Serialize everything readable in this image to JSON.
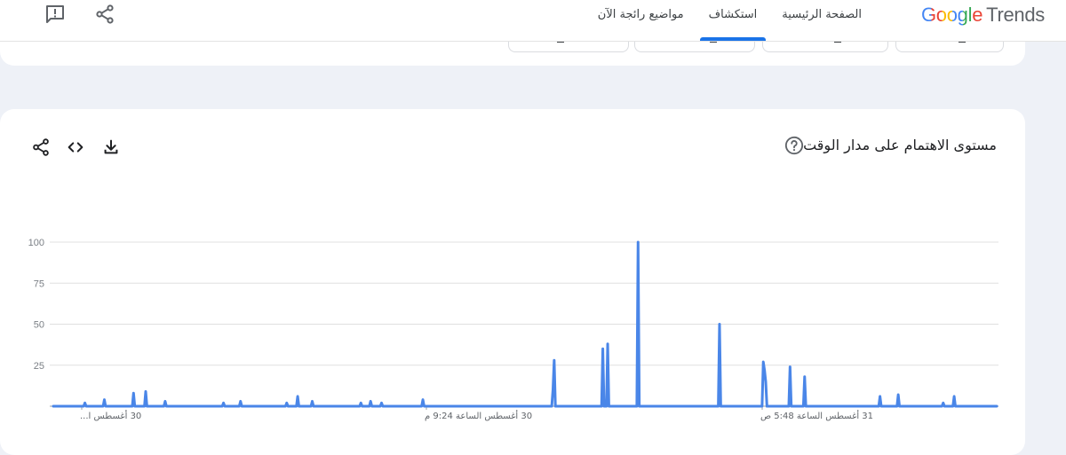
{
  "header": {
    "logo_google": "Google",
    "logo_trends": "Trends",
    "nav": [
      {
        "label": "الصفحة الرئيسية",
        "active": false
      },
      {
        "label": "استكشاف",
        "active": true
      },
      {
        "label": "مواضيع رائجة الآن",
        "active": false
      }
    ],
    "icons": [
      "feedback-icon",
      "share-icon"
    ]
  },
  "card": {
    "title": "مستوى الاهتمام على مدار الوقت",
    "icons": [
      "help-icon",
      "download-icon",
      "embed-icon",
      "share-icon"
    ]
  },
  "colors": {
    "accent": "#1a73e8",
    "series": "#4a86e8",
    "grid": "#e0e0e0"
  },
  "chart_data": {
    "type": "line",
    "title": "",
    "ylim": [
      0,
      100
    ],
    "yticks": [
      25,
      50,
      75,
      100
    ],
    "grid": true,
    "xtick_labels": [
      "30 أغسطس ا...",
      "30 أغسطس الساعة 9:24 م",
      "31 أغسطس الساعة 5:48 ص"
    ],
    "series": [
      {
        "values": [
          0,
          0,
          0,
          0,
          0,
          0,
          0,
          0,
          0,
          0,
          0,
          0,
          0,
          0,
          0,
          0,
          0,
          0,
          0,
          0,
          0,
          0,
          0,
          0,
          0,
          0,
          2,
          0,
          0,
          0,
          0,
          0,
          0,
          0,
          0,
          0,
          0,
          0,
          0,
          0,
          0,
          0,
          4,
          0,
          0,
          0,
          0,
          0,
          0,
          0,
          0,
          0,
          0,
          0,
          0,
          0,
          0,
          0,
          0,
          0,
          0,
          0,
          0,
          0,
          0,
          0,
          8,
          0,
          0,
          0,
          0,
          0,
          0,
          0,
          0,
          0,
          9,
          0,
          0,
          0,
          0,
          0,
          0,
          0,
          0,
          0,
          0,
          0,
          0,
          0,
          0,
          0,
          3,
          0,
          0,
          0,
          0,
          0,
          0,
          0,
          0,
          0,
          0,
          0,
          0,
          0,
          0,
          0,
          0,
          0,
          0,
          0,
          0,
          0,
          0,
          0,
          0,
          0,
          0,
          0,
          0,
          0,
          0,
          0,
          0,
          0,
          0,
          0,
          0,
          0,
          0,
          0,
          0,
          0,
          0,
          0,
          0,
          0,
          0,
          0,
          2,
          0,
          0,
          0,
          0,
          0,
          0,
          0,
          0,
          0,
          0,
          0,
          0,
          0,
          3,
          0,
          0,
          0,
          0,
          0,
          0,
          0,
          0,
          0,
          0,
          0,
          0,
          0,
          0,
          0,
          0,
          0,
          0,
          0,
          0,
          0,
          0,
          0,
          0,
          0,
          0,
          0,
          0,
          0,
          0,
          0,
          0,
          0,
          0,
          0,
          0,
          0,
          2,
          0,
          0,
          0,
          0,
          0,
          0,
          0,
          0,
          6,
          0,
          0,
          0,
          0,
          0,
          0,
          0,
          0,
          0,
          0,
          0,
          3,
          0,
          0,
          0,
          0,
          0,
          0,
          0,
          0,
          0,
          0,
          0,
          0,
          0,
          0,
          0,
          0,
          0,
          0,
          0,
          0,
          0,
          0,
          0,
          0,
          0,
          0,
          0,
          0,
          0,
          0,
          0,
          0,
          0,
          0,
          0,
          0,
          0,
          0,
          0,
          2,
          0,
          0,
          0,
          0,
          0,
          0,
          0,
          3,
          0,
          0,
          0,
          0,
          0,
          0,
          0,
          0,
          2,
          0,
          0,
          0,
          0,
          0,
          0,
          0,
          0,
          0,
          0,
          0,
          0,
          0,
          0,
          0,
          0,
          0,
          0,
          0,
          0,
          0,
          0,
          0,
          0,
          0,
          0,
          0,
          0,
          0,
          0,
          0,
          0,
          0,
          4,
          0,
          0,
          0,
          0,
          0,
          0,
          0,
          0,
          0,
          0,
          0,
          0,
          0,
          0,
          0,
          0,
          0,
          0,
          0,
          0,
          0,
          0,
          0,
          0,
          0,
          0,
          0,
          0,
          0,
          0,
          0,
          0,
          0,
          0,
          0,
          0,
          0,
          0,
          0,
          0,
          0,
          0,
          0,
          0,
          0,
          0,
          0,
          0,
          0,
          0,
          0,
          0,
          0,
          0,
          0,
          0,
          0,
          0,
          0,
          0,
          0,
          0,
          0,
          0,
          0,
          0,
          0,
          0,
          0,
          0,
          0,
          0,
          0,
          0,
          0,
          0,
          0,
          0,
          0,
          0,
          0,
          0,
          0,
          0,
          0,
          0,
          0,
          0,
          0,
          0,
          0,
          0,
          0,
          0,
          0,
          0,
          0,
          0,
          0,
          0,
          0,
          0,
          0,
          0,
          0,
          0,
          10,
          28,
          0,
          0,
          0,
          0,
          0,
          0,
          0,
          0,
          0,
          0,
          0,
          0,
          0,
          0,
          0,
          0,
          0,
          0,
          0,
          0,
          0,
          0,
          0,
          0,
          0,
          0,
          0,
          0,
          0,
          0,
          0,
          0,
          0,
          0,
          0,
          0,
          0,
          0,
          0,
          35,
          0,
          0,
          0,
          38,
          0,
          0,
          0,
          0,
          0,
          0,
          0,
          0,
          0,
          0,
          0,
          0,
          0,
          0,
          0,
          0,
          0,
          0,
          0,
          0,
          0,
          0,
          0,
          0,
          100,
          0,
          0,
          0,
          0,
          0,
          0,
          0,
          0,
          0,
          0,
          0,
          0,
          0,
          0,
          0,
          0,
          0,
          0,
          0,
          0,
          0,
          0,
          0,
          0,
          0,
          0,
          0,
          0,
          0,
          0,
          0,
          0,
          0,
          0,
          0,
          0,
          0,
          0,
          0,
          0,
          0,
          0,
          0,
          0,
          0,
          0,
          0,
          0,
          0,
          0,
          0,
          0,
          0,
          0,
          0,
          0,
          0,
          0,
          0,
          0,
          0,
          0,
          0,
          0,
          0,
          0,
          50,
          0,
          0,
          0,
          0,
          0,
          0,
          0,
          0,
          0,
          0,
          0,
          0,
          0,
          0,
          0,
          0,
          0,
          0,
          0,
          0,
          0,
          0,
          0,
          0,
          0,
          0,
          0,
          0,
          0,
          0,
          0,
          0,
          0,
          0,
          0,
          27,
          22,
          15,
          0,
          0,
          0,
          0,
          0,
          0,
          0,
          0,
          0,
          0,
          0,
          0,
          0,
          0,
          0,
          0,
          0,
          0,
          0,
          24,
          0,
          0,
          0,
          0,
          0,
          0,
          0,
          0,
          0,
          0,
          0,
          18,
          0,
          0,
          0,
          0,
          0,
          0,
          0,
          0,
          0,
          0,
          0,
          0,
          0,
          0,
          0,
          0,
          0,
          0,
          0,
          0,
          0,
          0,
          0,
          0,
          0,
          0,
          0,
          0,
          0,
          0,
          0,
          0,
          0,
          0,
          0,
          0,
          0,
          0,
          0,
          0,
          0,
          0,
          0,
          0,
          0,
          0,
          0,
          0,
          0,
          0,
          0,
          0,
          0,
          0,
          0,
          0,
          0,
          0,
          0,
          0,
          0,
          6,
          0,
          0,
          0,
          0,
          0,
          0,
          0,
          0,
          0,
          0,
          0,
          0,
          0,
          0,
          7,
          0,
          0,
          0,
          0,
          0,
          0,
          0,
          0,
          0,
          0,
          0,
          0,
          0,
          0,
          0,
          0,
          0,
          0,
          0,
          0,
          0,
          0,
          0,
          0,
          0,
          0,
          0,
          0,
          0,
          0,
          0,
          0,
          0,
          0,
          0,
          0,
          2,
          0,
          0,
          0,
          0,
          0,
          0,
          0,
          0,
          6,
          0,
          0,
          0,
          0,
          0,
          0,
          0,
          0,
          0,
          0,
          0,
          0,
          0,
          0,
          0,
          0,
          0,
          0,
          0,
          0,
          0,
          0,
          0,
          0,
          0,
          0,
          0,
          0,
          0,
          0,
          0,
          0,
          0,
          0,
          0
        ]
      }
    ]
  }
}
